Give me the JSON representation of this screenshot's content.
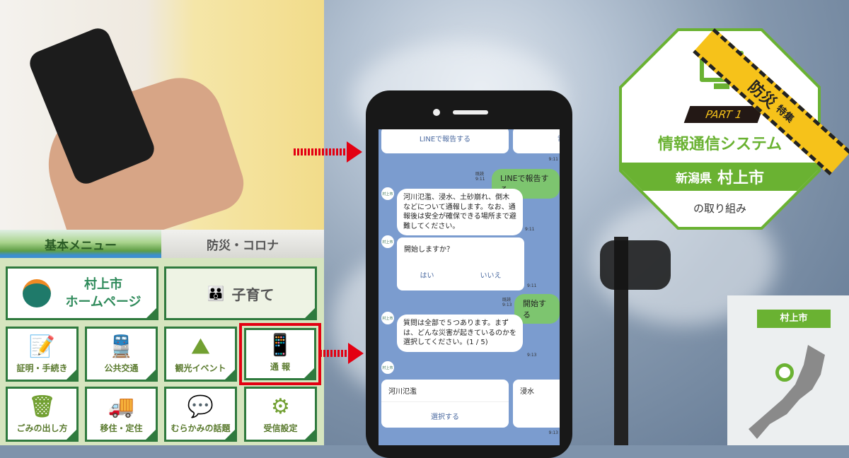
{
  "menu": {
    "tabs": [
      {
        "label": "基本メニュー",
        "active": true
      },
      {
        "label": "防災・コロナ",
        "active": false
      }
    ],
    "tiles": [
      {
        "label": "村上市\nホームページ",
        "icon": "city-logo-icon"
      },
      {
        "label": "子育て",
        "icon": "family-icon"
      },
      {
        "label": "証明・手続き",
        "icon": "document-pen-icon"
      },
      {
        "label": "公共交通",
        "icon": "train-icon"
      },
      {
        "label": "観光イベント",
        "icon": "mountain-fan-icon"
      },
      {
        "label": "通 報",
        "icon": "phone-alert-icon",
        "highlighted": true
      },
      {
        "label": "ごみの出し方",
        "icon": "trash-icon"
      },
      {
        "label": "移住・定住",
        "icon": "truck-icon"
      },
      {
        "label": "むらかみの話題",
        "icon": "chat-bubbles-icon"
      },
      {
        "label": "受信設定",
        "icon": "gear-icon"
      }
    ]
  },
  "chat": {
    "top_buttons": [
      "LINEで報告する",
      "電"
    ],
    "messages": [
      {
        "from": "user",
        "text": "LINEで報告する",
        "read": "既読",
        "time": "9:11"
      },
      {
        "from": "bot",
        "text": "河川氾濫、浸水、土砂崩れ、倒木などについて通報します。なお、通報後は安全が確保できる場所まで避難してください。",
        "time": "9:11"
      },
      {
        "from": "bot",
        "text": "開始しますか？",
        "options": [
          "はい",
          "いいえ"
        ],
        "time": "9:11"
      },
      {
        "from": "user",
        "text": "開始する",
        "read": "既読",
        "time": "9:13"
      },
      {
        "from": "bot",
        "text": "質問は全部で５つあります。まずは、どんな災害が起きているのかを選択してください。(1 / 5)",
        "time": "9:13"
      }
    ],
    "carousel": [
      {
        "title": "河川氾濫",
        "action": "選択する"
      },
      {
        "title": "浸水"
      }
    ],
    "times": [
      "9:11",
      "9:13"
    ],
    "avatar_label": "村上市"
  },
  "badge": {
    "part": "PART 1",
    "title": "情報通信システム",
    "region": "新潟県",
    "city": "村上市",
    "subtitle": "の取り組み",
    "tape": "防災",
    "tape_small": "特集",
    "color": "#6ab232"
  },
  "map": {
    "label": "村上市"
  },
  "colors": {
    "highlight": "#e30012",
    "chat_bg": "#7b9ccf",
    "user_bubble": "#7dc56f"
  }
}
